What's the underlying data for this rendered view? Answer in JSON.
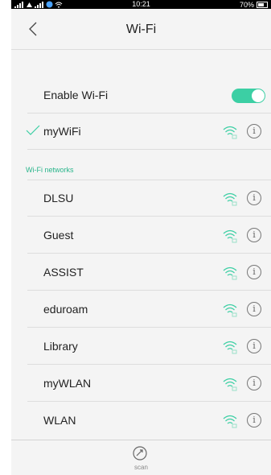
{
  "status_bar": {
    "time": "10:21",
    "battery": "70%"
  },
  "header": {
    "title": "Wi-Fi"
  },
  "enable_wifi": {
    "label": "Enable Wi-Fi",
    "enabled": true
  },
  "connected_network": {
    "name": "myWiFi"
  },
  "section": {
    "header": "Wi-Fi networks"
  },
  "networks": [
    {
      "name": "DLSU"
    },
    {
      "name": "Guest"
    },
    {
      "name": "ASSIST"
    },
    {
      "name": "eduroam"
    },
    {
      "name": "Library"
    },
    {
      "name": "myWLAN"
    },
    {
      "name": "WLAN"
    }
  ],
  "bottom_bar": {
    "scan_label": "scan"
  },
  "colors": {
    "accent": "#3ccfa4",
    "section_text": "#29b58b",
    "background": "#f4f4f4"
  }
}
